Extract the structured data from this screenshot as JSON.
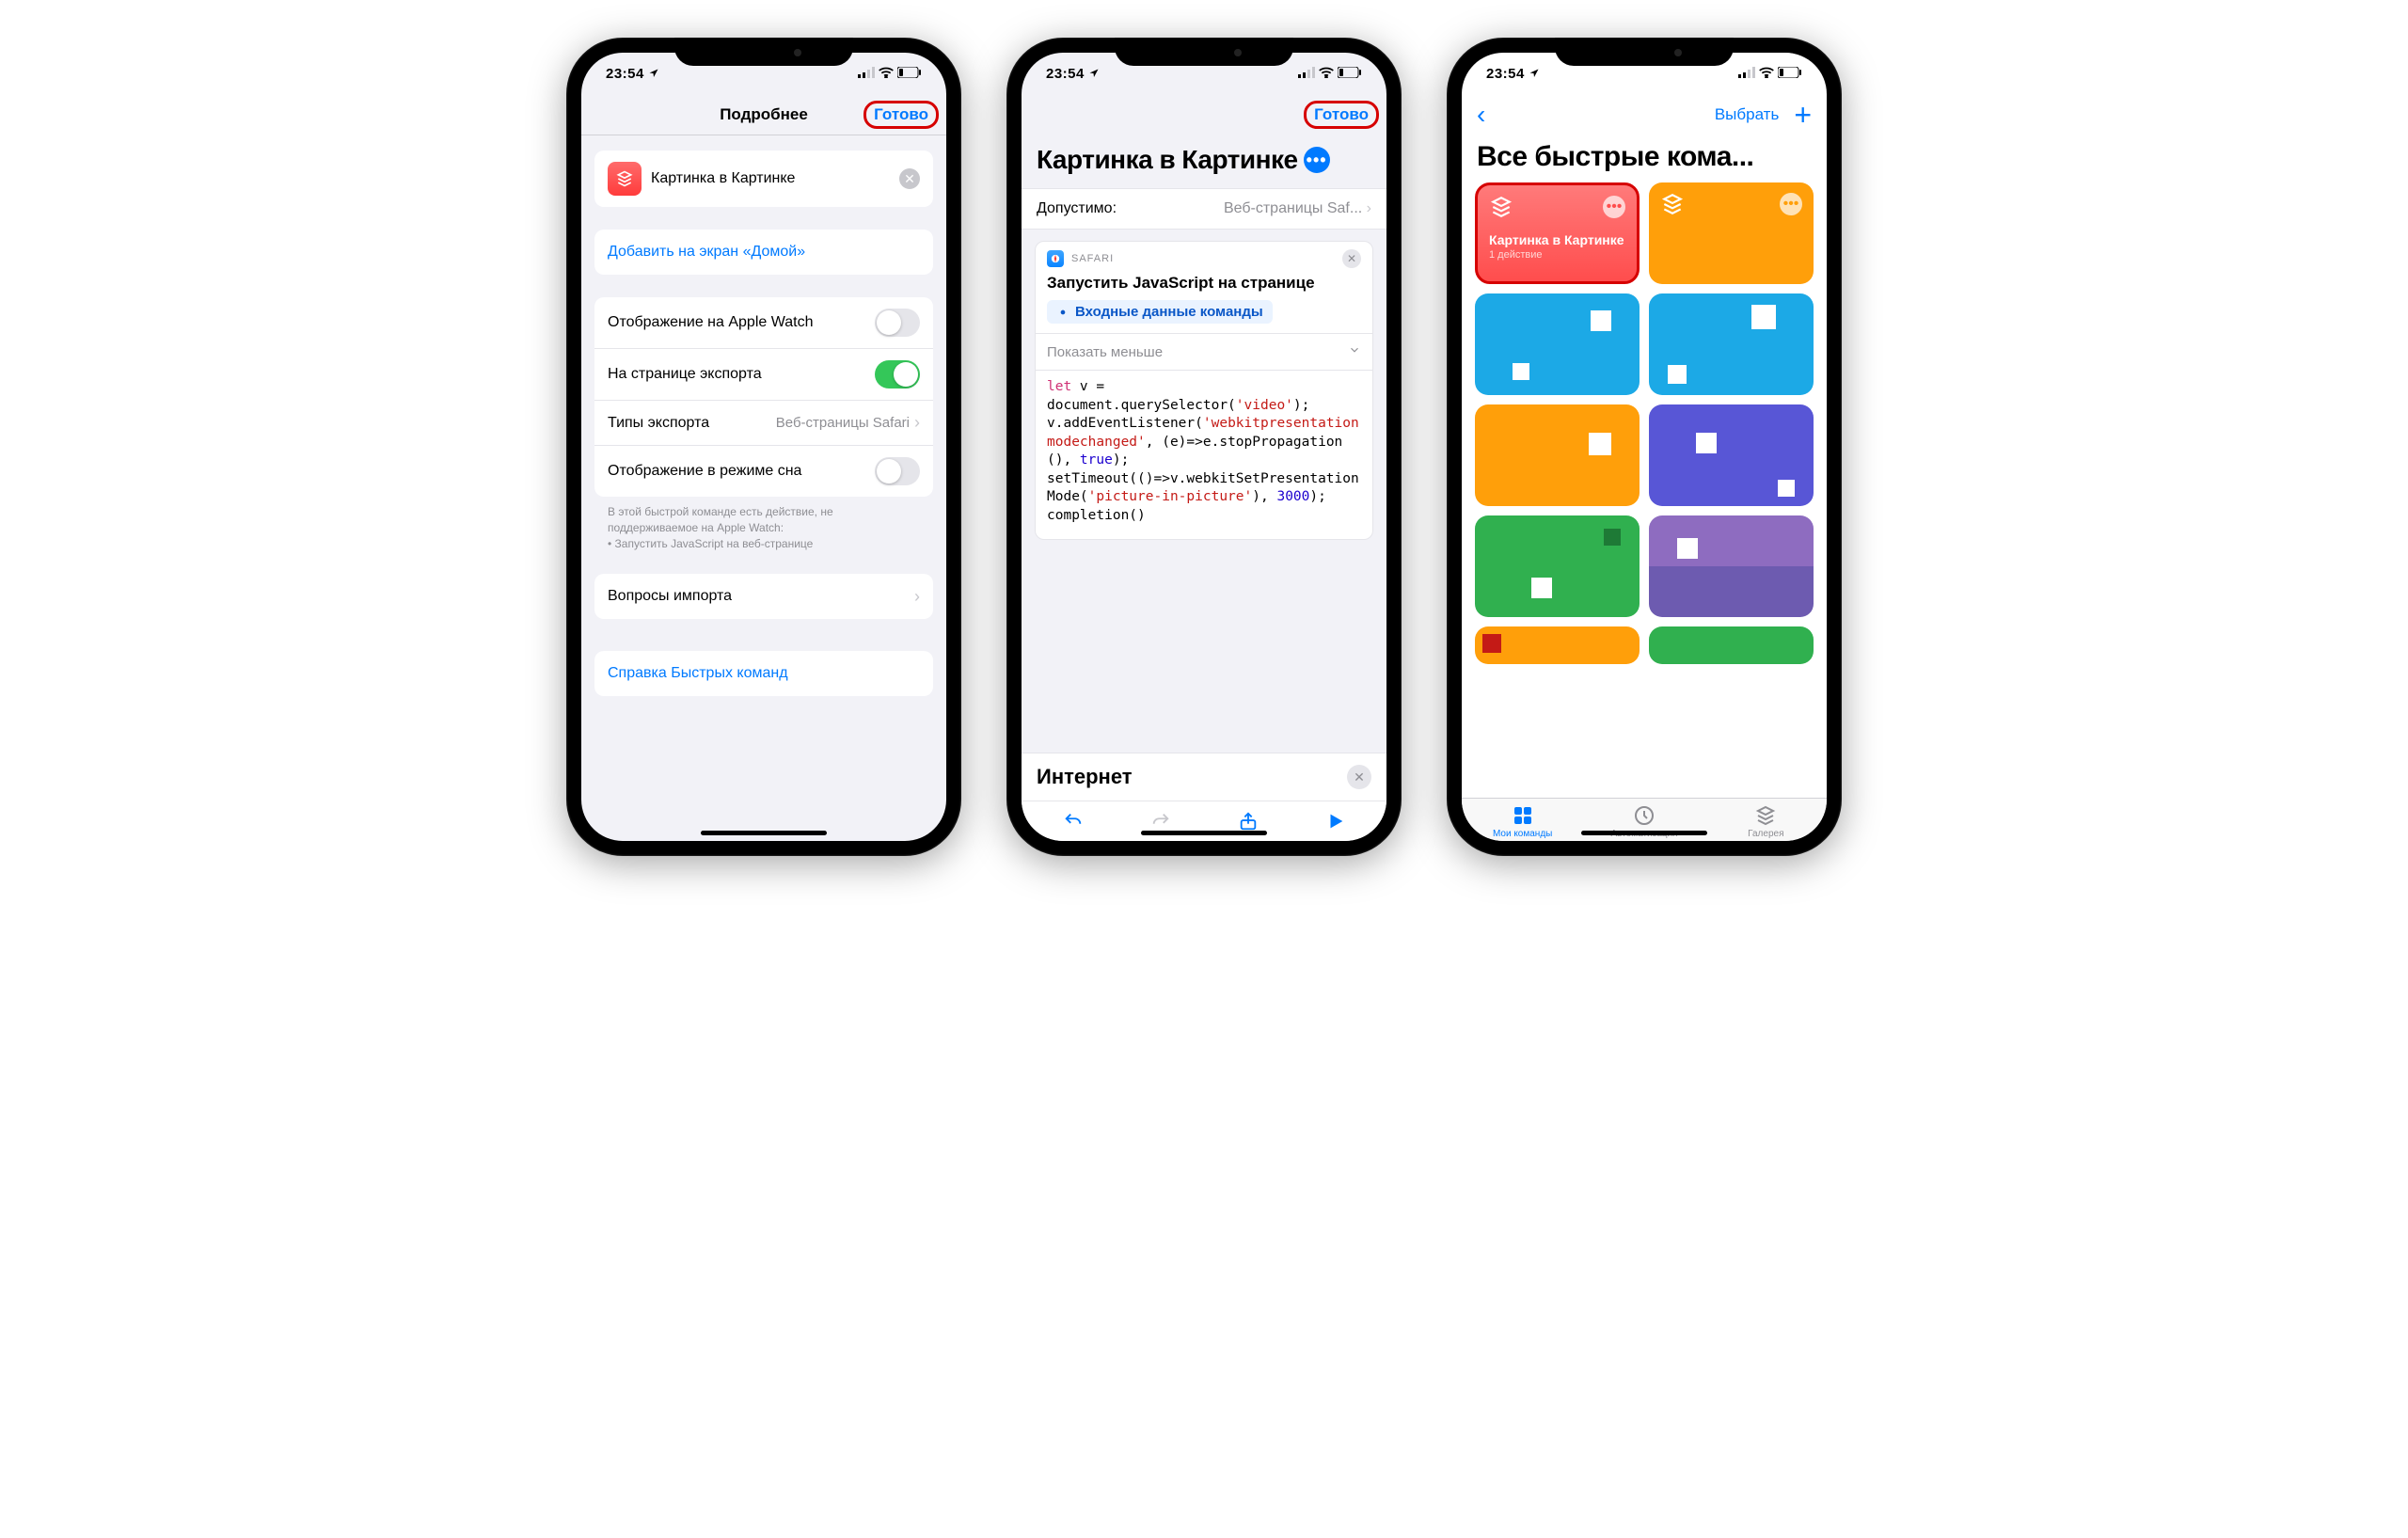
{
  "status": {
    "time": "23:54",
    "signal": "••ıl",
    "wifi": true,
    "battery_low": true
  },
  "screen1": {
    "nav": {
      "title": "Подробнее",
      "done": "Готово"
    },
    "name_row": {
      "value": "Картинка в Картинке"
    },
    "add_home": "Добавить на экран «Домой»",
    "settings": {
      "watch": {
        "label": "Отображение на Apple Watch",
        "on": false
      },
      "export_page": {
        "label": "На странице экспорта",
        "on": true
      },
      "export_types": {
        "label": "Типы экспорта",
        "value": "Веб-страницы Safari"
      },
      "sleep_mode": {
        "label": "Отображение в режиме сна",
        "on": false
      }
    },
    "footnote": "В этой быстрой команде есть действие, не поддерживаемое на Apple Watch:\n• Запустить JavaScript на веб-странице",
    "import_q": "Вопросы импорта",
    "help": "Справка Быстрых команд"
  },
  "screen2": {
    "done": "Готово",
    "title": "Картинка в Картинке",
    "param": {
      "label": "Допустимо:",
      "value": "Веб-страницы Saf..."
    },
    "action": {
      "app": "SAFARI",
      "title": "Запустить JavaScript на странице",
      "pill": "Входные данные команды",
      "collapse": "Показать меньше"
    },
    "code_plain": "let v = document.querySelector('video');\nv.addEventListener('webkitpresentationmodechanged', (e)=>e.stopPropagation(), true);\nsetTimeout(()=>v.webkitSetPresentationMode('picture-in-picture'), 3000);\ncompletion()",
    "sheet_title": "Интернет"
  },
  "screen3": {
    "select": "Выбрать",
    "heading": "Все быстрые кома...",
    "tile1": {
      "title": "Картинка в Картинке",
      "sub": "1 действие"
    },
    "tile_colors": [
      "#ff5a5a",
      "#ff9f0a",
      "#1ca9e6",
      "#1ca9e6",
      "#ff9f0a",
      "#5856d6",
      "#30b04f",
      "#6d5bb0"
    ],
    "tabs": {
      "my": "Мои команды",
      "auto": "Автоматизация",
      "gallery": "Галерея"
    }
  }
}
